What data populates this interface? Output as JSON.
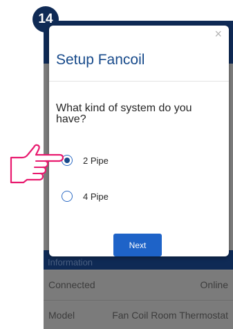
{
  "step_number": "14",
  "modal": {
    "title": "Setup Fancoil",
    "close_glyph": "×",
    "question": "What kind of system do you have?",
    "options": [
      {
        "label": "2 Pipe",
        "selected": true
      },
      {
        "label": "4 Pipe",
        "selected": false
      }
    ],
    "next_label": "Next"
  },
  "background": {
    "section_label": "Information",
    "rows": [
      {
        "label": "Connected",
        "value": "Online"
      },
      {
        "label": "Model",
        "value": "Fan Coil Room Thermostat"
      }
    ]
  },
  "colors": {
    "accent": "#1e63c8",
    "title": "#16498a",
    "header_navy": "#0f2a55",
    "pointer": "#e8196e"
  },
  "icons": {
    "pointer": "pointing-hand-icon",
    "close": "close-icon"
  }
}
